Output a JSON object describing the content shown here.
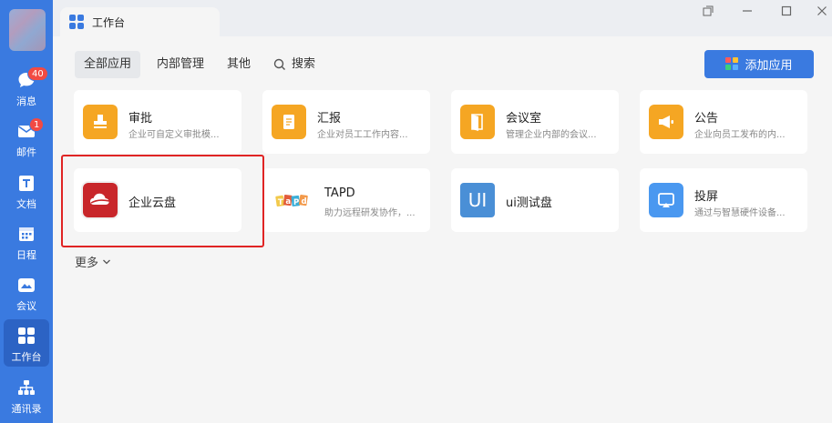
{
  "sidebar": {
    "items": [
      {
        "label": "消息",
        "icon": "chat-bubble-icon",
        "badge": "40"
      },
      {
        "label": "邮件",
        "icon": "mail-icon",
        "badge": "1"
      },
      {
        "label": "文档",
        "icon": "document-icon"
      },
      {
        "label": "日程",
        "icon": "calendar-icon"
      },
      {
        "label": "会议",
        "icon": "meeting-icon"
      },
      {
        "label": "工作台",
        "icon": "workbench-grid-icon",
        "active": true
      },
      {
        "label": "通讯录",
        "icon": "contacts-icon"
      }
    ]
  },
  "tab": {
    "title": "工作台",
    "icon": "workbench-grid-icon"
  },
  "window_controls": [
    "popout-icon",
    "minimize-icon",
    "maximize-icon",
    "close-icon"
  ],
  "filters": [
    {
      "label": "全部应用",
      "active": true
    },
    {
      "label": "内部管理"
    },
    {
      "label": "其他"
    },
    {
      "label": "搜索",
      "icon": "search-icon"
    }
  ],
  "add_button": {
    "label": "添加应用",
    "icon": "colorful-grid-icon"
  },
  "apps": [
    {
      "name": "审批",
      "desc": "企业可自定义审批模...",
      "icon": "stamp-icon",
      "color": "#f5a623"
    },
    {
      "name": "汇报",
      "desc": "企业对员工工作内容...",
      "icon": "report-icon",
      "color": "#f5a623"
    },
    {
      "name": "会议室",
      "desc": "管理企业内部的会议...",
      "icon": "door-icon",
      "color": "#f5a623"
    },
    {
      "name": "公告",
      "desc": "企业向员工发布的内...",
      "icon": "megaphone-icon",
      "color": "#f5a623"
    },
    {
      "name": "企业云盘",
      "desc": "",
      "icon": "cloud-icon",
      "color": "#c8262a"
    },
    {
      "name": "TAPD",
      "desc": "助力远程研发协作，...",
      "icon": "tapd-logo-icon",
      "color": "#ffffff"
    },
    {
      "name": "ui测试盘",
      "desc": "",
      "icon": "ui-text-icon",
      "color": "#4a8fd6",
      "icon_text": "UI"
    },
    {
      "name": "投屏",
      "desc": "通过与智慧硬件设备...",
      "icon": "screencast-icon",
      "color": "#4a98f0"
    }
  ],
  "more_label": "更多"
}
